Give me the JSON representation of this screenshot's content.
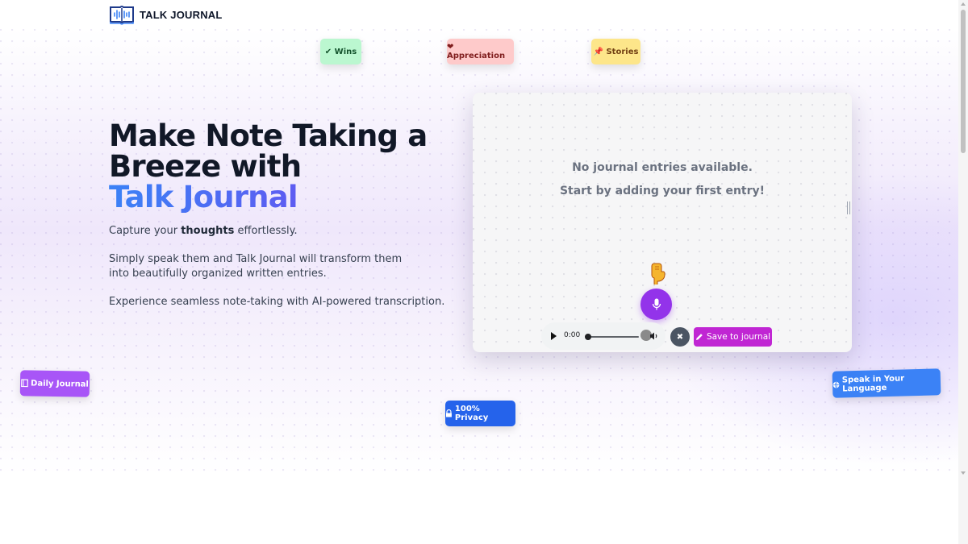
{
  "header": {
    "logo_text": "TALK JOURNAL",
    "logo_icon": "book-soundwave-icon"
  },
  "tags": {
    "wins": "✔ Wins",
    "appreciation": "❤ Appreciation",
    "stories": "📌 Stories",
    "daily_journal": "Daily Journal",
    "privacy": "100% Privacy",
    "language": "Speak in Your Language"
  },
  "hero": {
    "headline_line1": "Make Note Taking a",
    "headline_line2": "Breeze with",
    "headline_brand": "Talk Journal",
    "intro_prefix": "Capture your ",
    "intro_bold": "thoughts",
    "intro_suffix": " effortlessly.",
    "para2": "Simply speak them and Talk Journal will transform them into beautifully organized written entries.",
    "para3": "Experience seamless note-taking with AI-powered transcription."
  },
  "journal": {
    "empty_title": "No journal entries available.",
    "empty_subtitle": "Start by adding your first entry!",
    "audio_time": "0:00",
    "audio_progress": 0,
    "clear_label": "✖",
    "save_label": "Save to journal"
  },
  "colors": {
    "brand_gradient_start": "#3b82f6",
    "brand_gradient_end": "#7c3aed",
    "mic_button": "#9333ea",
    "save_button": "#c026d3"
  }
}
